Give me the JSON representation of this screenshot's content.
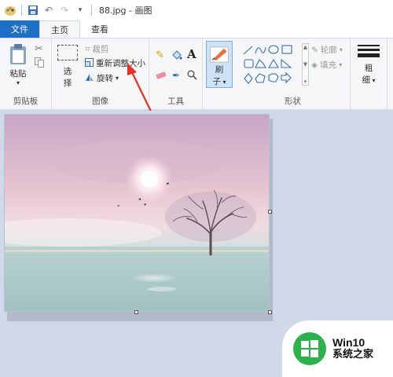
{
  "window": {
    "title": "88.jpg - 画图"
  },
  "tabs": [
    {
      "label": "文件"
    },
    {
      "label": "主页"
    },
    {
      "label": "查看"
    }
  ],
  "ribbon": {
    "clipboard": {
      "label": "剪贴板",
      "paste": "粘贴"
    },
    "image": {
      "label": "图像",
      "select_line1": "选",
      "select_line2": "择",
      "crop": "裁剪",
      "resize": "重新调整大小",
      "rotate": "旋转"
    },
    "tools": {
      "label": "工具"
    },
    "brushes": {
      "line1": "刷",
      "line2": "子"
    },
    "shapes": {
      "label": "形状",
      "outline": "轮廓",
      "fill": "填充"
    },
    "size": {
      "line1": "粗",
      "line2": "细"
    }
  },
  "watermark": {
    "brand": "Win10",
    "sub": "系统之家"
  },
  "colors": {
    "file_tab": "#1e6fc6",
    "accent_arrow": "#e8302a",
    "canvas_bg": "#cfd9e8"
  }
}
